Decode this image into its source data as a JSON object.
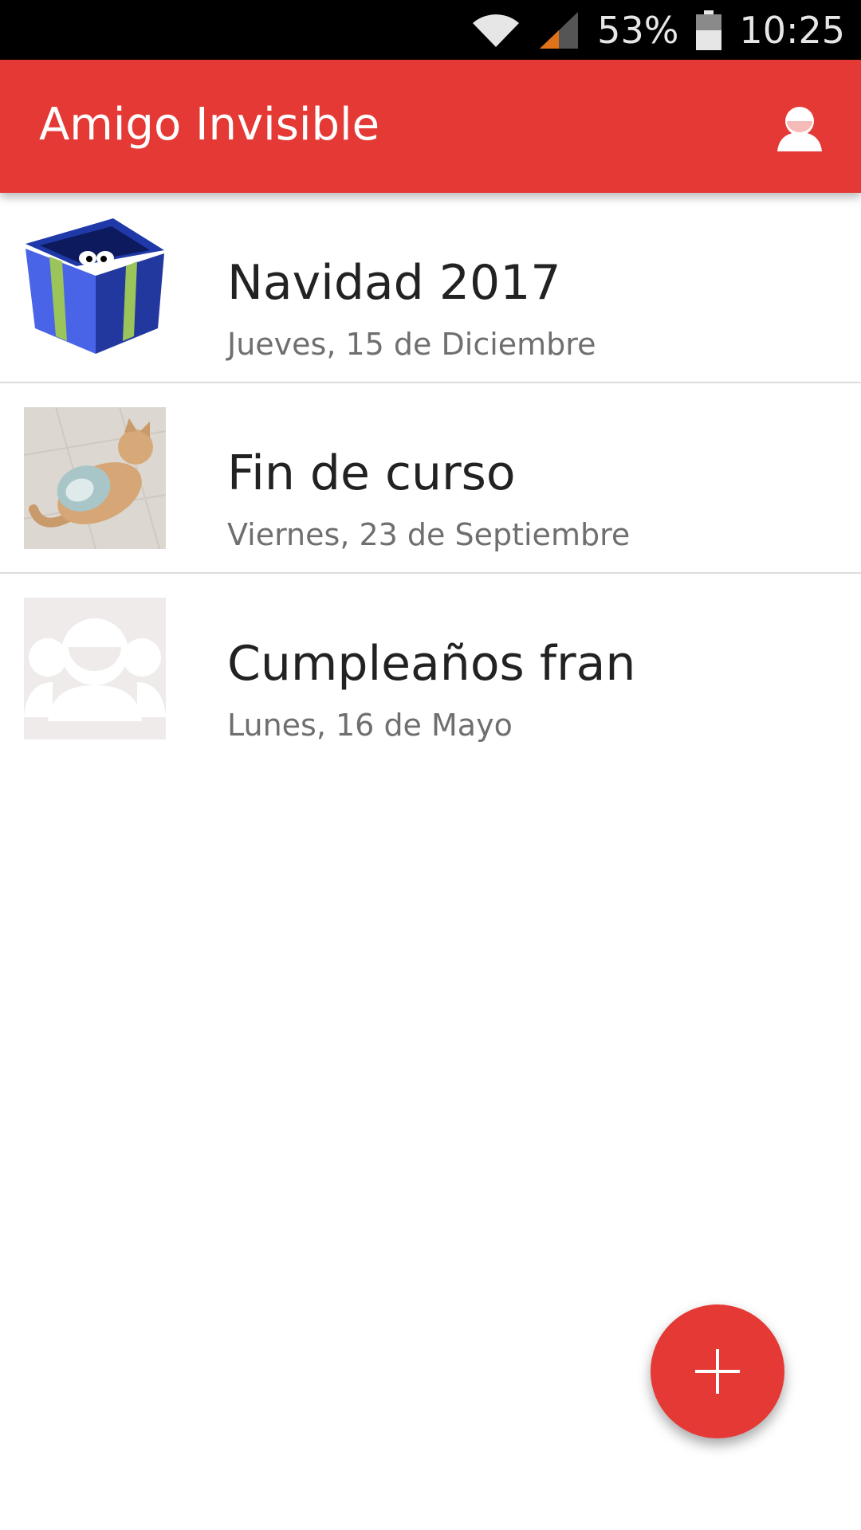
{
  "status_bar": {
    "battery_percent": "53%",
    "time": "10:25",
    "icons": [
      "wifi-icon",
      "signal-icon",
      "battery-icon"
    ]
  },
  "app_bar": {
    "title": "Amigo Invisible",
    "account_icon": "account-icon"
  },
  "events": [
    {
      "title": "Navidad 2017",
      "date": "Jueves, 15 de Diciembre",
      "thumbnail": "gift-box-image"
    },
    {
      "title": "Fin de curso",
      "date": "Viernes, 23 de Septiembre",
      "thumbnail": "cat-photo-image"
    },
    {
      "title": "Cumpleaños fran",
      "date": "Lunes, 16 de Mayo",
      "thumbnail": "group-placeholder-image"
    }
  ],
  "fab": {
    "icon": "plus-icon"
  },
  "colors": {
    "primary": "#e53935",
    "status_bar": "#000000",
    "title_text": "#222222",
    "subtitle_text": "#6f6f6f",
    "divider": "#dcdcdc",
    "placeholder_bg": "#efebea"
  }
}
